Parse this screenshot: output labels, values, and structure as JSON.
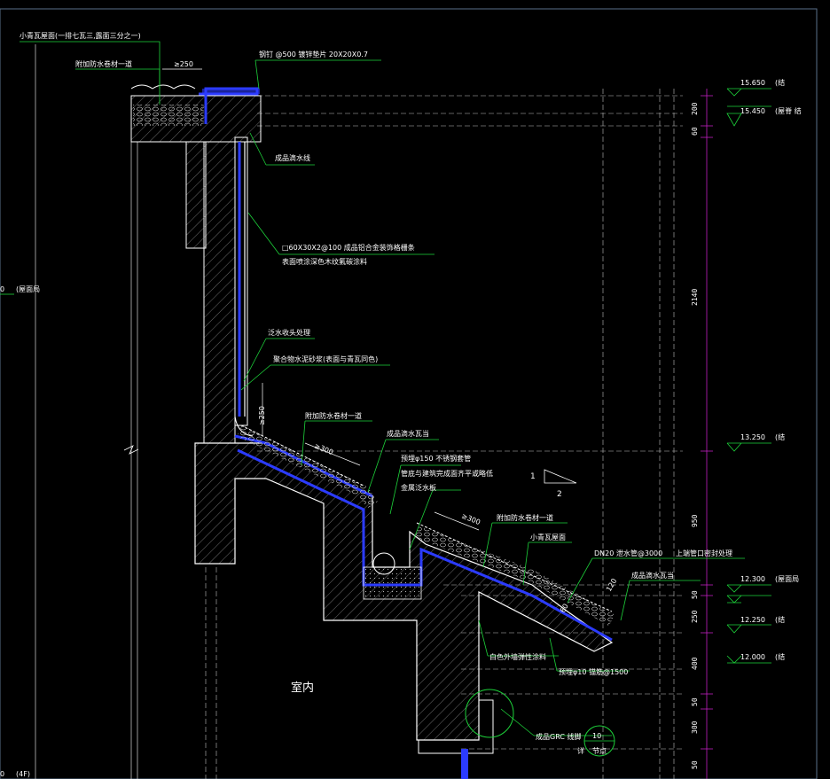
{
  "colors": {
    "background": "#000000",
    "leader": "#1dd23a",
    "wall": "#ffffff",
    "waterproof": "#2b3bff",
    "dimension": "#c020c0",
    "grid": "#bfbfbf",
    "hatch": "#a0a0a0"
  },
  "annotations": {
    "roof_tile_spec": "小青瓦屋面(一排七瓦三,露面三分之一)",
    "extra_waterproof_1": "附加防水卷材一道",
    "overlap_top": "≥250",
    "flashing_spec": "钢钉 @500 镀锌垫片  20X20X0.7",
    "drip_line": "成品滴水线",
    "alu_grille_1": "□60X30X2@100  成品铝合金装饰格栅条",
    "alu_grille_2": "表面喷涂深色木纹氟碳涂料",
    "flashing_end": "泛水收头处理",
    "mortar": "聚合物水泥砂浆(表面与青瓦同色)",
    "overlap_side": "≥250",
    "extra_waterproof_2": "附加防水卷材一道",
    "overlap_mid": "≥300",
    "drip_tile_1": "成品滴水瓦当",
    "steel_pipe_1": "预埋φ150  不锈钢套管",
    "steel_pipe_2": "管底与建筑完成面齐平或略低",
    "metal_flashing": "金属泛水板",
    "overlap_low": "≥300",
    "extra_waterproof_3": "附加防水卷材一道",
    "tile_roof": "小青瓦屋面",
    "drain_pipe": "DN20  泄水管@3000",
    "pipe_seal": "上端管口密封处理",
    "drip_tile_2": "成品滴水瓦当",
    "dim_120": "120",
    "dim_60": "60",
    "exterior_paint": "白色外墙弹性涂料",
    "embed_bar": "预埋φ10  锚筋@1500",
    "grc_line": "成品GRC  线脚",
    "detail_ref_1": "详",
    "detail_ref_2": "节点",
    "detail_num": "10",
    "interior": "室内",
    "slope_1": "1",
    "slope_2": "2"
  },
  "elevations": [
    {
      "value": "15.650",
      "note": "(结"
    },
    {
      "value": "15.450",
      "note": "(屋脊  结"
    },
    {
      "value": "13.250",
      "note": "(结"
    },
    {
      "value": "12.300",
      "note": "(屋面局"
    },
    {
      "value": "12.250",
      "note": "(结"
    },
    {
      "value": "12.000",
      "note": "(结"
    }
  ],
  "left_level": {
    "value": "0",
    "note": "(屋面局"
  },
  "floor_label": {
    "value": "0",
    "note": "(4F)"
  },
  "dimensions": [
    "200",
    "60",
    "2140",
    "950",
    "50",
    "250",
    "400",
    "50",
    "300",
    "50"
  ]
}
